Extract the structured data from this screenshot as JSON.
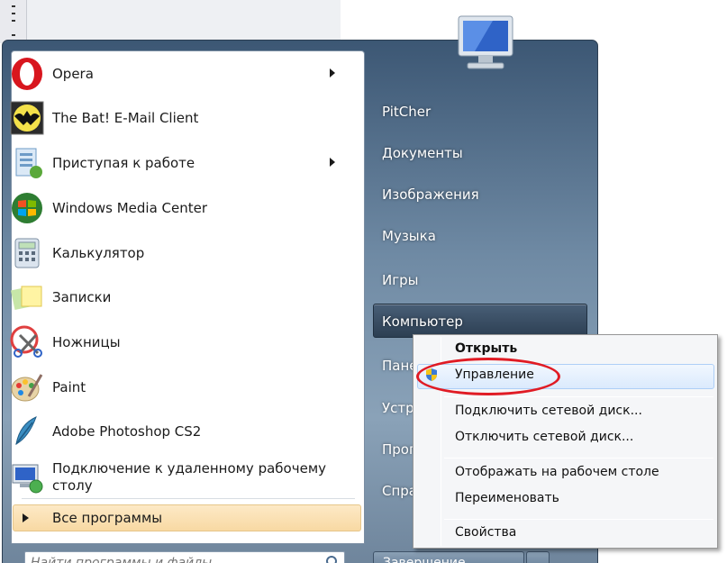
{
  "start_menu": {
    "programs": [
      {
        "label": "Opera",
        "icon": "opera-icon",
        "has_submenu": true
      },
      {
        "label": "The Bat! E-Mail Client",
        "icon": "the-bat-icon",
        "has_submenu": false
      },
      {
        "label": "Приступая к работе",
        "icon": "getting-started-icon",
        "has_submenu": true
      },
      {
        "label": "Windows Media Center",
        "icon": "media-center-icon",
        "has_submenu": false
      },
      {
        "label": "Калькулятор",
        "icon": "calculator-icon",
        "has_submenu": false
      },
      {
        "label": "Записки",
        "icon": "sticky-notes-icon",
        "has_submenu": false
      },
      {
        "label": "Ножницы",
        "icon": "snipping-tool-icon",
        "has_submenu": false
      },
      {
        "label": "Paint",
        "icon": "paint-icon",
        "has_submenu": false
      },
      {
        "label": "Adobe Photoshop CS2",
        "icon": "photoshop-icon",
        "has_submenu": false
      },
      {
        "label": "Подключение к удаленному рабочему\nстолу",
        "icon": "remote-desktop-icon",
        "has_submenu": false
      }
    ],
    "all_programs": "Все программы",
    "search_placeholder": "Найти программы и файлы",
    "right_items": [
      "PitCher",
      "Документы",
      "Изображения",
      "Музыка",
      "Игры",
      "Компьютер",
      "Пане",
      "Устр",
      "Прог",
      "Спра"
    ],
    "shutdown_label": "Завершение работы"
  },
  "context_menu": {
    "items": [
      {
        "label": "Открыть",
        "bold": true
      },
      {
        "label": "Управление",
        "highlighted": true,
        "icon": "uac-shield-icon"
      },
      {
        "label": "Подключить сетевой диск..."
      },
      {
        "label": "Отключить сетевой диск..."
      },
      {
        "label": "Отображать на рабочем столе"
      },
      {
        "label": "Переименовать"
      },
      {
        "label": "Свойства"
      }
    ]
  },
  "colors": {
    "highlight_ellipse": "#e01b24",
    "menu_frame": "#5f7a96",
    "all_programs_bg": "#f8d9a3"
  }
}
